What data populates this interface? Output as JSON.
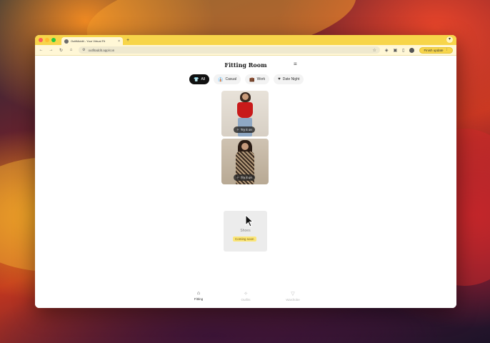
{
  "browser": {
    "tab_title": "OutfitAddit - Your Virtual Fit",
    "tab_close": "×",
    "new_tab": "+",
    "url": "outfitaddit.app/con",
    "finish_update": "Finish update",
    "finish_update_menu": "⋮"
  },
  "page": {
    "title": "Fitting Room"
  },
  "filters": [
    {
      "label": "All",
      "icon": "tshirt-icon"
    },
    {
      "label": "Casual",
      "icon": "shirt-icon"
    },
    {
      "label": "Work",
      "icon": "briefcase-icon"
    },
    {
      "label": "Date Night",
      "icon": "heart-icon"
    }
  ],
  "cards": [
    {
      "try_on_label": "Try it on"
    },
    {
      "try_on_label": "Try it on"
    }
  ],
  "coming_card": {
    "label": "Shoes",
    "badge": "Coming soon"
  },
  "bottom_nav": [
    {
      "label": "Fitting",
      "icon": "hanger-icon",
      "active": true
    },
    {
      "label": "Outfits",
      "icon": "magic-wand-icon",
      "active": false
    },
    {
      "label": "Wardrobe",
      "icon": "bag-icon",
      "active": false
    }
  ],
  "colors": {
    "tabbar": "#f7d54a",
    "chip_active": "#111111",
    "badge": "#fbe67a"
  }
}
